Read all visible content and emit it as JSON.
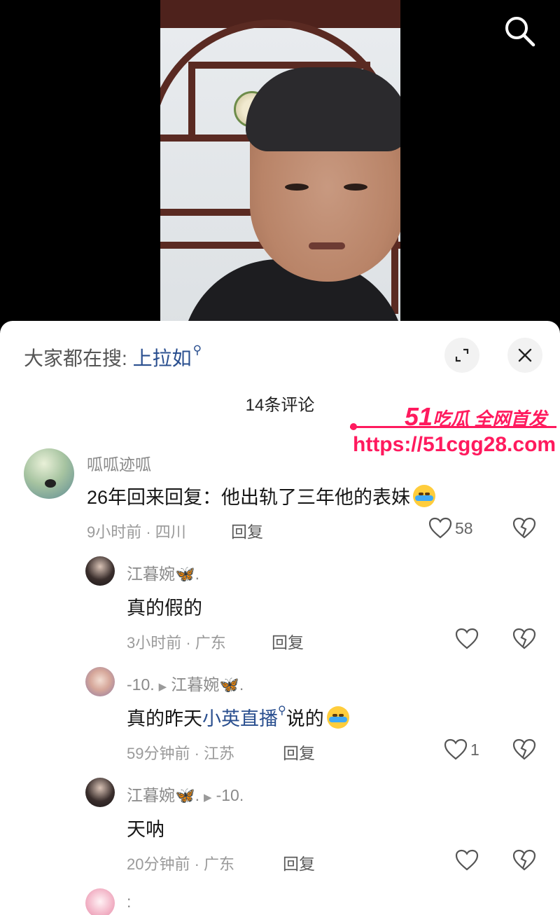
{
  "hot_search": {
    "prefix": "大家都在搜:",
    "keyword": "上拉如"
  },
  "comment_count": "14条评论",
  "watermark": {
    "big": "51",
    "title": "吃瓜 全网首发",
    "url": "https://51cgg28.com"
  },
  "comments": [
    {
      "user": "呱呱迹呱",
      "text": "26年回来回复：他出轨了三年他的表妹",
      "meta": "9小时前 · 四川",
      "reply": "回复",
      "likes": "58"
    },
    {
      "user": "江暮婉🦋.",
      "text": "真的假的",
      "meta": "3小时前 · 广东",
      "reply": "回复",
      "likes": ""
    },
    {
      "user": "-10.",
      "reply_to": "江暮婉🦋.",
      "text_before": "真的昨天",
      "keyword": "小英直播",
      "text_after": "说的",
      "meta": "59分钟前 · 江苏",
      "reply": "回复",
      "likes": "1"
    },
    {
      "user": "江暮婉🦋.",
      "reply_to": "-10.",
      "text": "天呐",
      "meta": "20分钟前 · 广东",
      "reply": "回复",
      "likes": ""
    },
    {
      "user": ":"
    }
  ]
}
